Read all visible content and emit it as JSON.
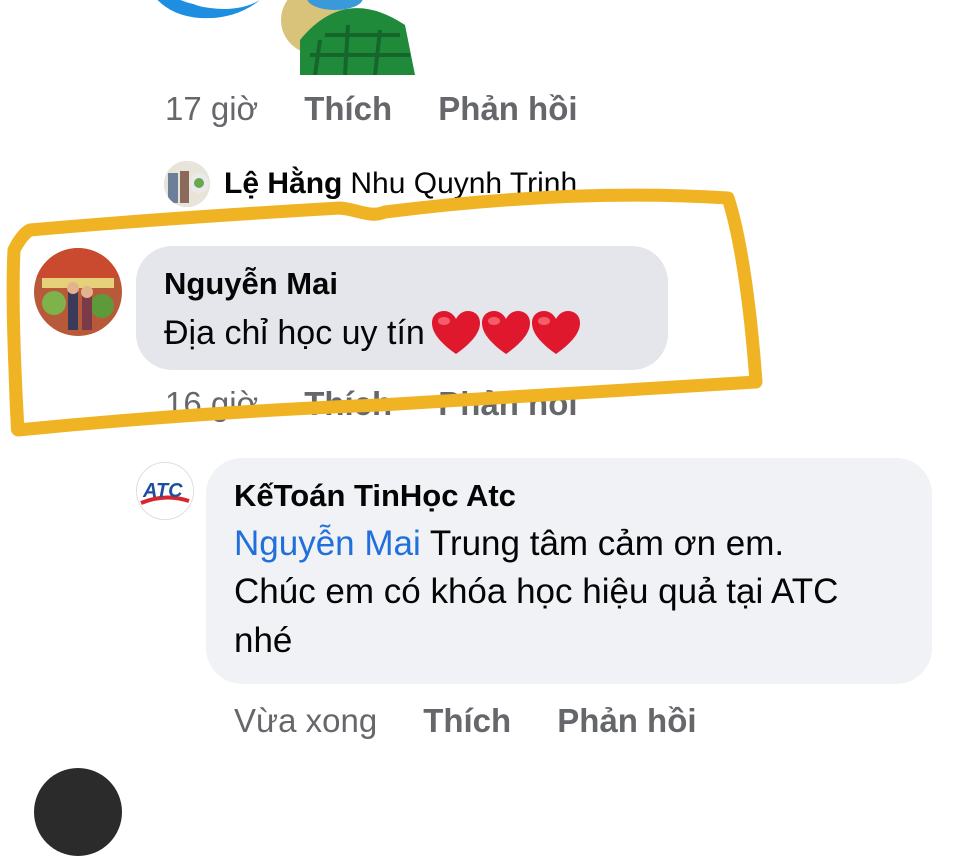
{
  "comment_top_meta": {
    "time": "17 giờ",
    "like": "Thích",
    "reply": "Phản hồi"
  },
  "collapsed_reply": {
    "name": "Lệ Hằng",
    "preview": "Nhu Quynh Trinh"
  },
  "comment_nguyen_mai": {
    "name": "Nguyễn Mai",
    "text": "Địa chỉ học uy tín",
    "hearts": 3,
    "time": "16 giờ",
    "like": "Thích",
    "reply": "Phản hồi"
  },
  "reply_atc": {
    "name": "KếToán TinHọc Atc",
    "mention": "Nguyễn Mai",
    "text": " Trung tâm cảm ơn em. Chúc em có khóa học hiệu quả tại ATC nhé",
    "time": "Vừa xong",
    "like": "Thích",
    "reply": "Phản hồi"
  },
  "colors": {
    "bubble": "#e4e6eb",
    "meta_text": "#65676b",
    "mention": "#216fdb",
    "highlight": "#f0b323",
    "heart": "#e0182d"
  }
}
